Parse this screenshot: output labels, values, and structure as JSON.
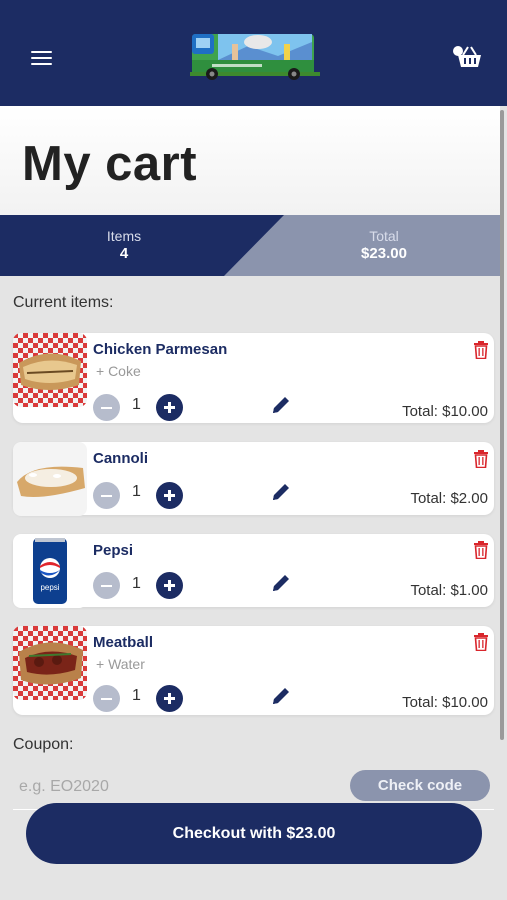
{
  "header": {
    "menu_icon": "hamburger-menu-icon",
    "logo_icon": "food-truck-logo-icon",
    "cart_icon": "basket-icon"
  },
  "page": {
    "title": "My cart"
  },
  "summary": {
    "items_label": "Items",
    "items_value": "4",
    "total_label": "Total",
    "total_value": "$23.00"
  },
  "current_items_label": "Current items:",
  "items": [
    {
      "name": "Chicken Parmesan",
      "sub": "+ Coke",
      "qty": "1",
      "total": "Total: $10.00",
      "image": "sandwich-image"
    },
    {
      "name": "Cannoli",
      "sub": "",
      "qty": "1",
      "total": "Total: $2.00",
      "image": "cannoli-image"
    },
    {
      "name": "Pepsi",
      "sub": "",
      "qty": "1",
      "total": "Total: $1.00",
      "image": "pepsi-can-image"
    },
    {
      "name": "Meatball",
      "sub": "+ Water",
      "qty": "1",
      "total": "Total: $10.00",
      "image": "meatball-sub-image"
    }
  ],
  "coupon": {
    "label": "Coupon:",
    "placeholder": "e.g. EO2020",
    "value": "",
    "check_label": "Check code"
  },
  "checkout_label": "Checkout with $23.00",
  "colors": {
    "navy": "#1c2c63",
    "muted_blue": "#8b94ad",
    "delete_red": "#d9262c",
    "background": "#e4e4e4"
  }
}
